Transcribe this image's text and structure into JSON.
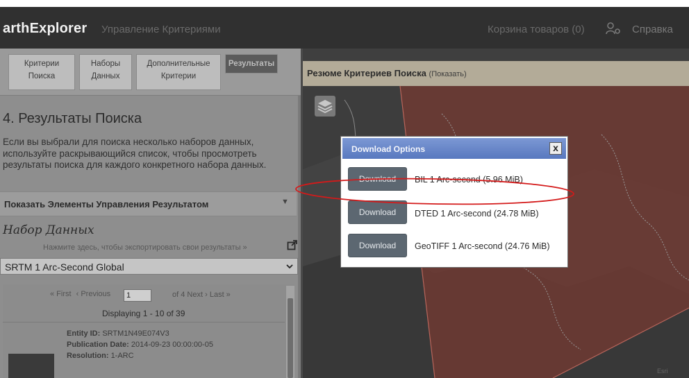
{
  "header": {
    "brand": "arthExplorer",
    "criteria_link": "Управление Критериями",
    "cart_link": "Корзина товаров (0)",
    "help_link": "Справка"
  },
  "tabs": [
    {
      "line1": "Критерии",
      "line2": "Поиска"
    },
    {
      "line1": "Наборы",
      "line2": "Данных"
    },
    {
      "line1": "Дополнительные",
      "line2": "Критерии"
    },
    {
      "line1": "Результаты",
      "line2": ""
    }
  ],
  "results": {
    "heading": "4. Результаты Поиска",
    "description": "Если вы выбрали для поиска несколько наборов данных, используйте раскрывающийся список, чтобы просмотреть результаты поиска для каждого конкретного набора данных.",
    "controls_label": "Показать Элементы Управления Результатом",
    "controls_caret": "▼",
    "dataset_title": "Набор Данных",
    "export_link": "Нажмите здесь, чтобы экспортировать свои результаты »",
    "dataset_selected": "SRTM 1 Arc-Second Global",
    "pager": {
      "first": "« First",
      "previous": "‹ Previous",
      "page_value": "1",
      "of_pages": "of 4",
      "next": "Next ›",
      "last": "Last »",
      "displaying": "Displaying 1 - 10 of 39"
    },
    "entity": {
      "id_label": "Entity ID:",
      "id_value": "SRTM1N49E074V3",
      "pub_label": "Publication Date:",
      "pub_value": "2014-09-23 00:00:00-05",
      "res_label": "Resolution:",
      "res_value": "1-ARC"
    }
  },
  "summary": {
    "title": "Резюме Критериев Поиска",
    "show": "(Показать)"
  },
  "modal": {
    "title": "Download Options",
    "close": "x",
    "options": [
      {
        "button": "Download",
        "label": "BIL 1 Arc-second (5.96 MiB)"
      },
      {
        "button": "Download",
        "label": "DTED 1 Arc-second (24.78 MiB)"
      },
      {
        "button": "Download",
        "label": "GeoTIFF 1 Arc-second (24.76 MiB)"
      }
    ]
  },
  "map": {
    "attribution": "Esri"
  },
  "colors": {
    "topbar": "#303030",
    "modal_header": "#5878bf",
    "download_button": "#5c6771",
    "annotation": "#d41a1a",
    "search_area": "#7a3a32"
  },
  "icons": {
    "user": "user-gear-icon",
    "layers": "layers-icon",
    "export": "export-icon",
    "select": "chevron-down-icon"
  }
}
